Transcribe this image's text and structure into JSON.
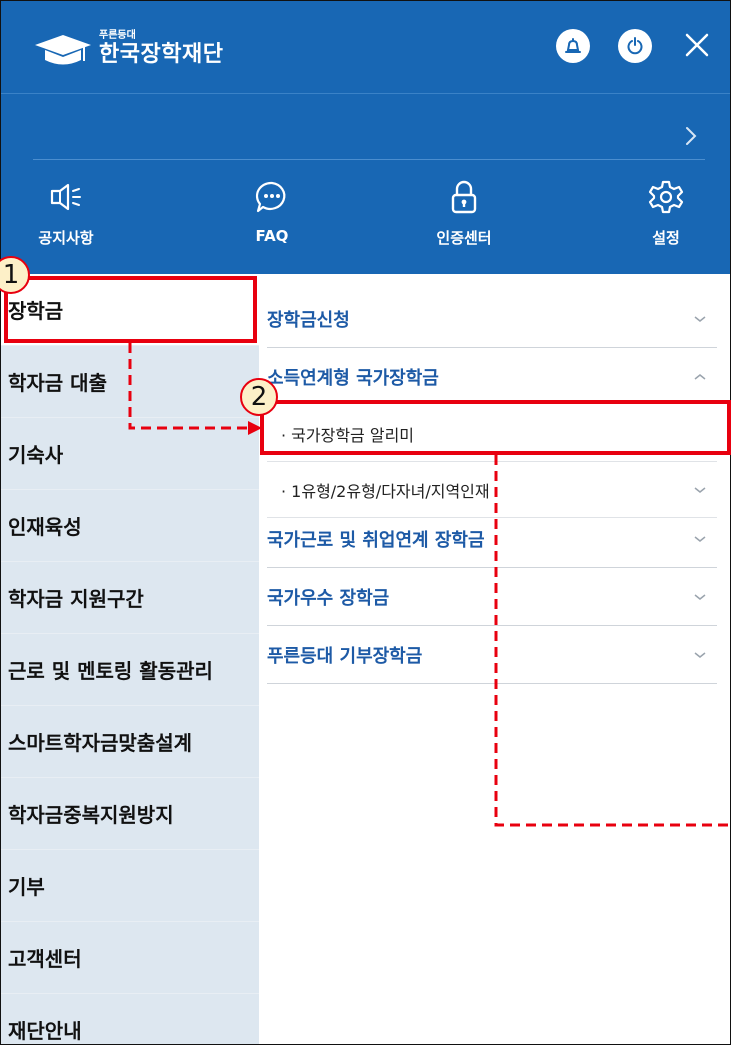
{
  "header": {
    "logo_sub": "푸른등대",
    "logo_main": "한국장학재단",
    "brand_color": "#1867b4"
  },
  "quick_nav": [
    {
      "label": "공지사항",
      "icon": "megaphone-icon"
    },
    {
      "label": "FAQ",
      "icon": "chat-bubble-icon"
    },
    {
      "label": "인증센터",
      "icon": "lock-icon"
    },
    {
      "label": "설정",
      "icon": "gear-icon"
    }
  ],
  "sidebar": {
    "items": [
      {
        "label": "장학금"
      },
      {
        "label": "학자금 대출"
      },
      {
        "label": "기숙사"
      },
      {
        "label": "인재육성"
      },
      {
        "label": "학자금 지원구간"
      },
      {
        "label": "근로 및 멘토링 활동관리"
      },
      {
        "label": "스마트학자금맞춤설계"
      },
      {
        "label": "학자금중복지원방지"
      },
      {
        "label": "기부"
      },
      {
        "label": "고객센터"
      },
      {
        "label": "재단안내"
      }
    ]
  },
  "submenu": {
    "items": [
      {
        "label": "장학금신청"
      },
      {
        "label": "소득연계형 국가장학금"
      },
      {
        "label": "· 국가장학금 알리미"
      },
      {
        "label": "· 1유형/2유형/다자녀/지역인재"
      },
      {
        "label": "국가근로 및 취업연계 장학금"
      },
      {
        "label": "국가우수 장학금"
      },
      {
        "label": "푸른등대 기부장학금"
      }
    ]
  },
  "annotations": {
    "step1": "1",
    "step2": "2",
    "color": "#e8000f"
  }
}
